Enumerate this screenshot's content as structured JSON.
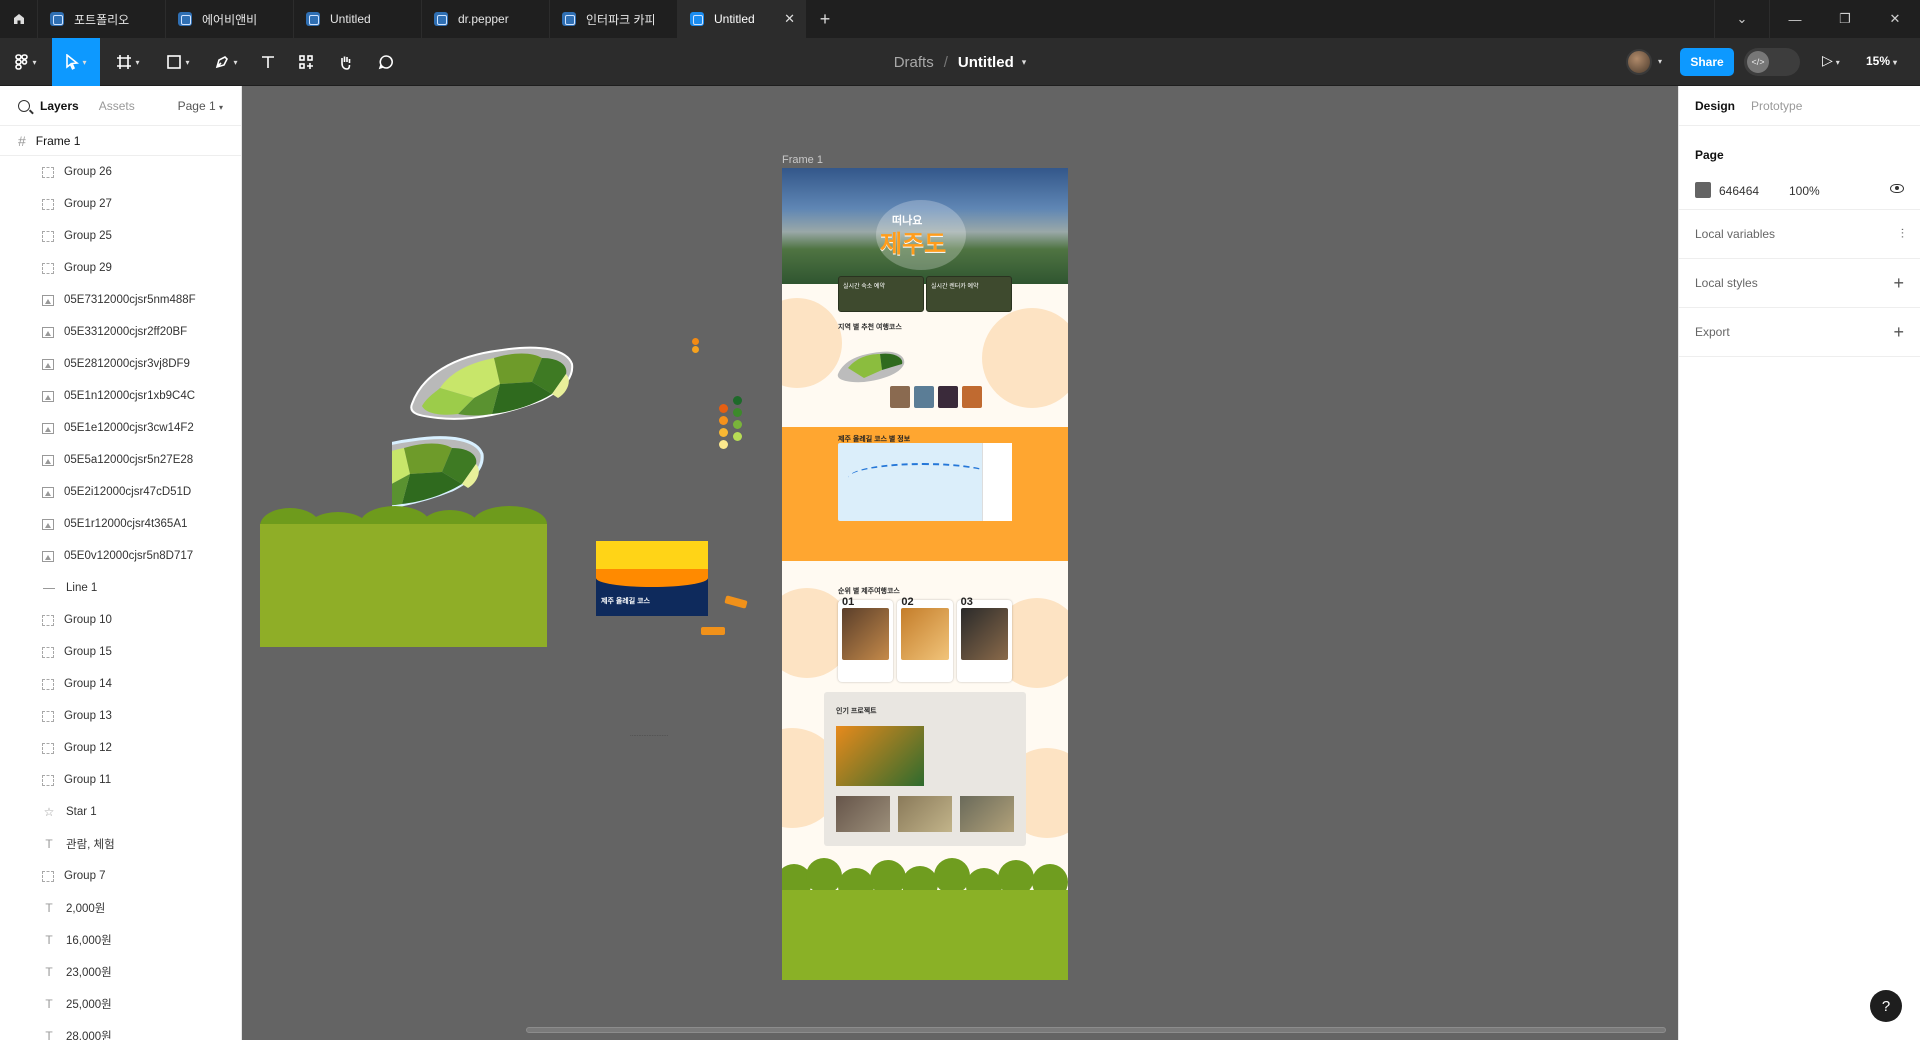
{
  "tabs": [
    {
      "label": "포트폴리오",
      "active": false
    },
    {
      "label": "에어비앤비",
      "active": false
    },
    {
      "label": "Untitled",
      "active": false
    },
    {
      "label": "dr.pepper",
      "active": false
    },
    {
      "label": "인터파크 카피",
      "active": false
    },
    {
      "label": "Untitled",
      "active": true
    }
  ],
  "toolbar": {
    "breadcrumb_root": "Drafts",
    "breadcrumb_sep": "/",
    "file_name": "Untitled",
    "share_label": "Share",
    "zoom_label": "15%"
  },
  "left_panel": {
    "tab_layers": "Layers",
    "tab_assets": "Assets",
    "page_selector": "Page 1",
    "frame_name": "Frame 1",
    "layers": [
      {
        "name": "Group 26",
        "type": "group"
      },
      {
        "name": "Group 27",
        "type": "group"
      },
      {
        "name": "Group 25",
        "type": "group"
      },
      {
        "name": "Group 29",
        "type": "group"
      },
      {
        "name": "05E7312000cjsr5nm488F",
        "type": "image"
      },
      {
        "name": "05E3312000cjsr2ff20BF",
        "type": "image"
      },
      {
        "name": "05E2812000cjsr3vj8DF9",
        "type": "image"
      },
      {
        "name": "05E1n12000cjsr1xb9C4C",
        "type": "image"
      },
      {
        "name": "05E1e12000cjsr3cw14F2",
        "type": "image"
      },
      {
        "name": "05E5a12000cjsr5n27E28",
        "type": "image"
      },
      {
        "name": "05E2i12000cjsr47cD51D",
        "type": "image"
      },
      {
        "name": "05E1r12000cjsr4t365A1",
        "type": "image"
      },
      {
        "name": "05E0v12000cjsr5n8D717",
        "type": "image"
      },
      {
        "name": "Line 1",
        "type": "line"
      },
      {
        "name": "Group 10",
        "type": "group"
      },
      {
        "name": "Group 15",
        "type": "group"
      },
      {
        "name": "Group 14",
        "type": "group"
      },
      {
        "name": "Group 13",
        "type": "group"
      },
      {
        "name": "Group 12",
        "type": "group"
      },
      {
        "name": "Group 11",
        "type": "group"
      },
      {
        "name": "Star 1",
        "type": "star"
      },
      {
        "name": "관람, 체험",
        "type": "text"
      },
      {
        "name": "Group 7",
        "type": "group"
      },
      {
        "name": "2,000원",
        "type": "text"
      },
      {
        "name": "16,000원",
        "type": "text"
      },
      {
        "name": "23,000원",
        "type": "text"
      },
      {
        "name": "25,000원",
        "type": "text"
      },
      {
        "name": "28,000원",
        "type": "text"
      }
    ]
  },
  "right_panel": {
    "tab_design": "Design",
    "tab_prototype": "Prototype",
    "page_title": "Page",
    "page_color_hex": "646464",
    "page_opacity": "100%",
    "local_variables": "Local variables",
    "local_styles": "Local styles",
    "export": "Export"
  },
  "canvas": {
    "frame_label": "Frame 1",
    "hero_small": "떠나요",
    "hero_big": "제주도",
    "card1": "실시간 숙소 예약",
    "card2": "실시간 렌터카 예약",
    "sec1_heading": "지역 별 추천 여행코스",
    "sec2_heading": "제주 올레길 코스 별 정보",
    "sec3_heading": "순위 별 제주여행코스",
    "sec4_heading": "인기 프로젝트",
    "rank_nums": [
      "01",
      "02",
      "03"
    ],
    "ticket_text": "제주 올레길 코스"
  },
  "colors": {
    "accent": "#0d99ff",
    "canvas_bg": "#646464",
    "orange": "#ffa630",
    "green": "#8ab126"
  }
}
